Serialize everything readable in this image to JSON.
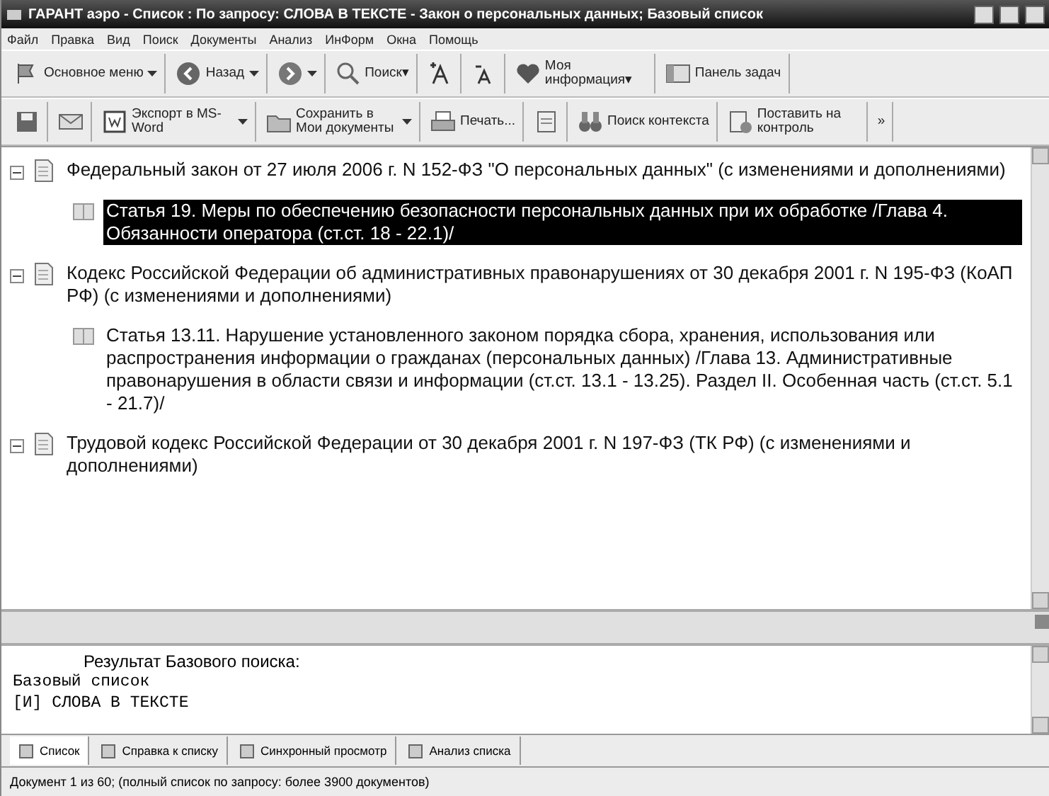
{
  "window": {
    "title": "ГАРАНТ аэро - Список : По запросу: СЛОВА В ТЕКСТЕ - Закон о персональных данных; Базовый список"
  },
  "menu": [
    "Файл",
    "Правка",
    "Вид",
    "Поиск",
    "Документы",
    "Анализ",
    "ИнФорм",
    "Окна",
    "Помощь"
  ],
  "toolbar1": [
    {
      "kind": "flag",
      "label": "Основное меню",
      "dropdown": true
    },
    {
      "kind": "back",
      "label": "Назад",
      "dropdown": true
    },
    {
      "kind": "forward",
      "dropdown": true
    },
    {
      "kind": "search",
      "label": "Поиск▾",
      "dropdown": false
    },
    {
      "kind": "fontup",
      "dropdown": false
    },
    {
      "kind": "fontdown",
      "dropdown": false
    },
    {
      "kind": "heart",
      "label": "Моя информация▾",
      "dropdown": false
    },
    {
      "kind": "panel",
      "label": "Панель задач",
      "dropdown": false
    }
  ],
  "toolbar2": [
    {
      "kind": "save",
      "dropdown": false
    },
    {
      "kind": "mail",
      "dropdown": false
    },
    {
      "kind": "word",
      "label": "Экспорт в MS-Word",
      "dropdown": true
    },
    {
      "kind": "folder",
      "label": "Сохранить в Мои документы",
      "dropdown": true
    },
    {
      "kind": "print",
      "label": "Печать...",
      "dropdown": false
    },
    {
      "kind": "preview",
      "dropdown": false
    },
    {
      "kind": "binoc",
      "label": "Поиск контекста",
      "dropdown": false
    },
    {
      "kind": "control",
      "label": "Поставить на контроль",
      "dropdown": false
    },
    {
      "kind": "more",
      "label": "»",
      "dropdown": false
    }
  ],
  "tree": [
    {
      "text": "Федеральный закон от 27 июля 2006 г. N 152-ФЗ \"О персональных данных\" (с изменениями и дополнениями)",
      "expanded": true,
      "selected": false,
      "children": [
        {
          "text": "Статья 19. Меры по обеспечению безопасности персональных данных при их обработке /Глава 4. Обязанности оператора (ст.ст. 18 - 22.1)/",
          "selected": true
        }
      ]
    },
    {
      "text": "Кодекс Российской Федерации об административных правонарушениях от 30 декабря 2001 г. N 195-ФЗ (КоАП РФ) (с изменениями и дополнениями)",
      "expanded": true,
      "selected": false,
      "children": [
        {
          "text": "Статья 13.11. Нарушение установленного законом порядка сбора, хранения, использования или распространения информации о гражданах (персональных данных) /Глава 13. Административные правонарушения в области связи и информации (ст.ст. 13.1 - 13.25). Раздел II. Особенная часть (ст.ст. 5.1 - 21.7)/",
          "selected": false
        }
      ]
    },
    {
      "text": "Трудовой кодекс Российской Федерации от 30 декабря 2001 г. N 197-ФЗ (ТК РФ) (с изменениями и дополнениями)",
      "expanded": true,
      "selected": false
    }
  ],
  "lower": {
    "heading": "Результат Базового поиска:",
    "lines": [
      "Базовый список",
      "[И] СЛОВА В ТЕКСТЕ"
    ]
  },
  "tabs": [
    {
      "label": "Список",
      "selected": true
    },
    {
      "label": "Справка к списку",
      "selected": false
    },
    {
      "label": "Синхронный просмотр",
      "selected": false
    },
    {
      "label": "Анализ списка",
      "selected": false
    }
  ],
  "status_bar": "Документ 1 из 60; (полный список по запросу: более 3900 документов)"
}
